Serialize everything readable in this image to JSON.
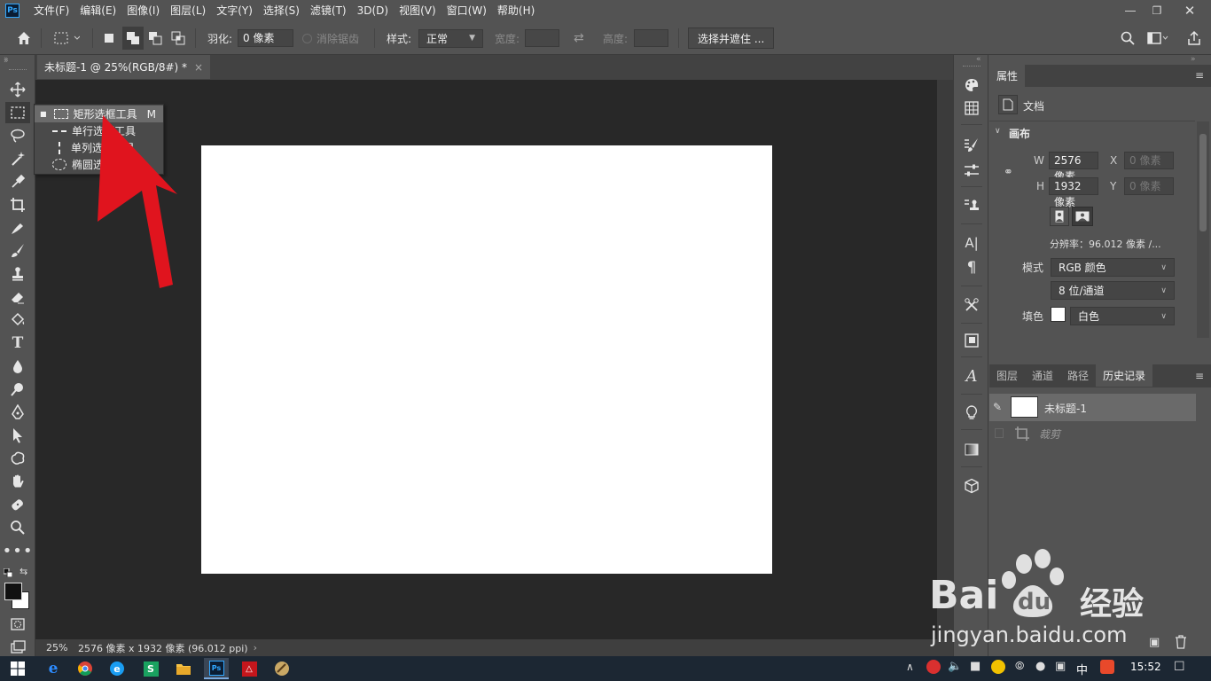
{
  "menubar": {
    "app_badge": "Ps",
    "items": [
      "文件(F)",
      "编辑(E)",
      "图像(I)",
      "图层(L)",
      "文字(Y)",
      "选择(S)",
      "滤镜(T)",
      "3D(D)",
      "视图(V)",
      "窗口(W)",
      "帮助(H)"
    ]
  },
  "options": {
    "feather_label": "羽化:",
    "feather_value": "0 像素",
    "antialias_label": "消除锯齿",
    "style_label": "样式:",
    "style_value": "正常",
    "width_label": "宽度:",
    "height_label": "高度:",
    "select_mask_button": "选择并遮住 ..."
  },
  "document": {
    "tab_title": "未标题-1 @ 25%(RGB/8#) *",
    "tab_close": "×"
  },
  "status": {
    "zoom": "25%",
    "info": "2576 像素 x 1932 像素 (96.012 ppi)"
  },
  "flyout": {
    "items": [
      {
        "label": "矩形选框工具",
        "shortcut": "M"
      },
      {
        "label": "单行选框工具"
      },
      {
        "label": "单列选框工具"
      },
      {
        "label": "椭圆选框工具"
      }
    ]
  },
  "properties": {
    "tab": "属性",
    "doc_label": "文档",
    "section": "画布",
    "w_label": "W",
    "w_value": "2576 像素",
    "h_label": "H",
    "h_value": "1932 像素",
    "x_label": "X",
    "x_placeholder": "0 像素",
    "y_label": "Y",
    "y_placeholder": "0 像素",
    "resolution": "分辨率：96.012 像素 /...",
    "mode_label": "模式",
    "mode_value": "RGB 颜色",
    "depth_value": "8 位/通道",
    "fill_label": "填色",
    "fill_value": "白色"
  },
  "layers_panel": {
    "tabs": [
      "图层",
      "通道",
      "路径",
      "历史记录"
    ],
    "active_tab": 3,
    "history": [
      {
        "label": "未标题-1"
      },
      {
        "label": "裁剪"
      }
    ]
  },
  "taskbar": {
    "ime": "中",
    "time": "15:52"
  },
  "watermark": {
    "brand": "Bai",
    "brand_cn": "经验",
    "url": "jingyan.baidu.com"
  },
  "colors": {
    "ui_gray": "#535353",
    "canvas_bg": "#282828",
    "arrow_red": "#e0141e",
    "ps_blue": "#31a8ff"
  }
}
